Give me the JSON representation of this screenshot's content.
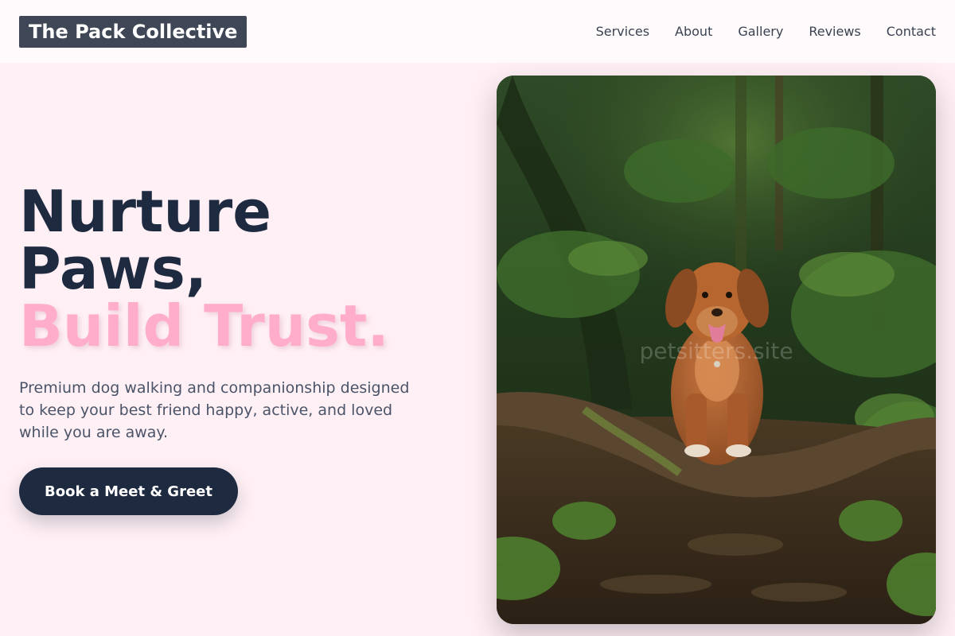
{
  "brand": {
    "name": "The Pack Collective"
  },
  "nav": {
    "items": [
      {
        "label": "Services"
      },
      {
        "label": "About"
      },
      {
        "label": "Gallery"
      },
      {
        "label": "Reviews"
      },
      {
        "label": "Contact"
      }
    ]
  },
  "hero": {
    "title_line1": "Nurture",
    "title_line2": "Paws,",
    "title_accent": "Build Trust.",
    "description": "Premium dog walking and companionship designed to keep your best friend happy, active, and loved while you are away.",
    "cta_label": "Book a Meet & Greet",
    "image_watermark": "petsitters.site"
  },
  "colors": {
    "background": "#fff0f5",
    "header_background": "#fffbfc",
    "logo_background": "#3f4756",
    "primary_dark": "#1e2a40",
    "accent_pink": "#ffadcb",
    "body_text": "#4a5468"
  }
}
